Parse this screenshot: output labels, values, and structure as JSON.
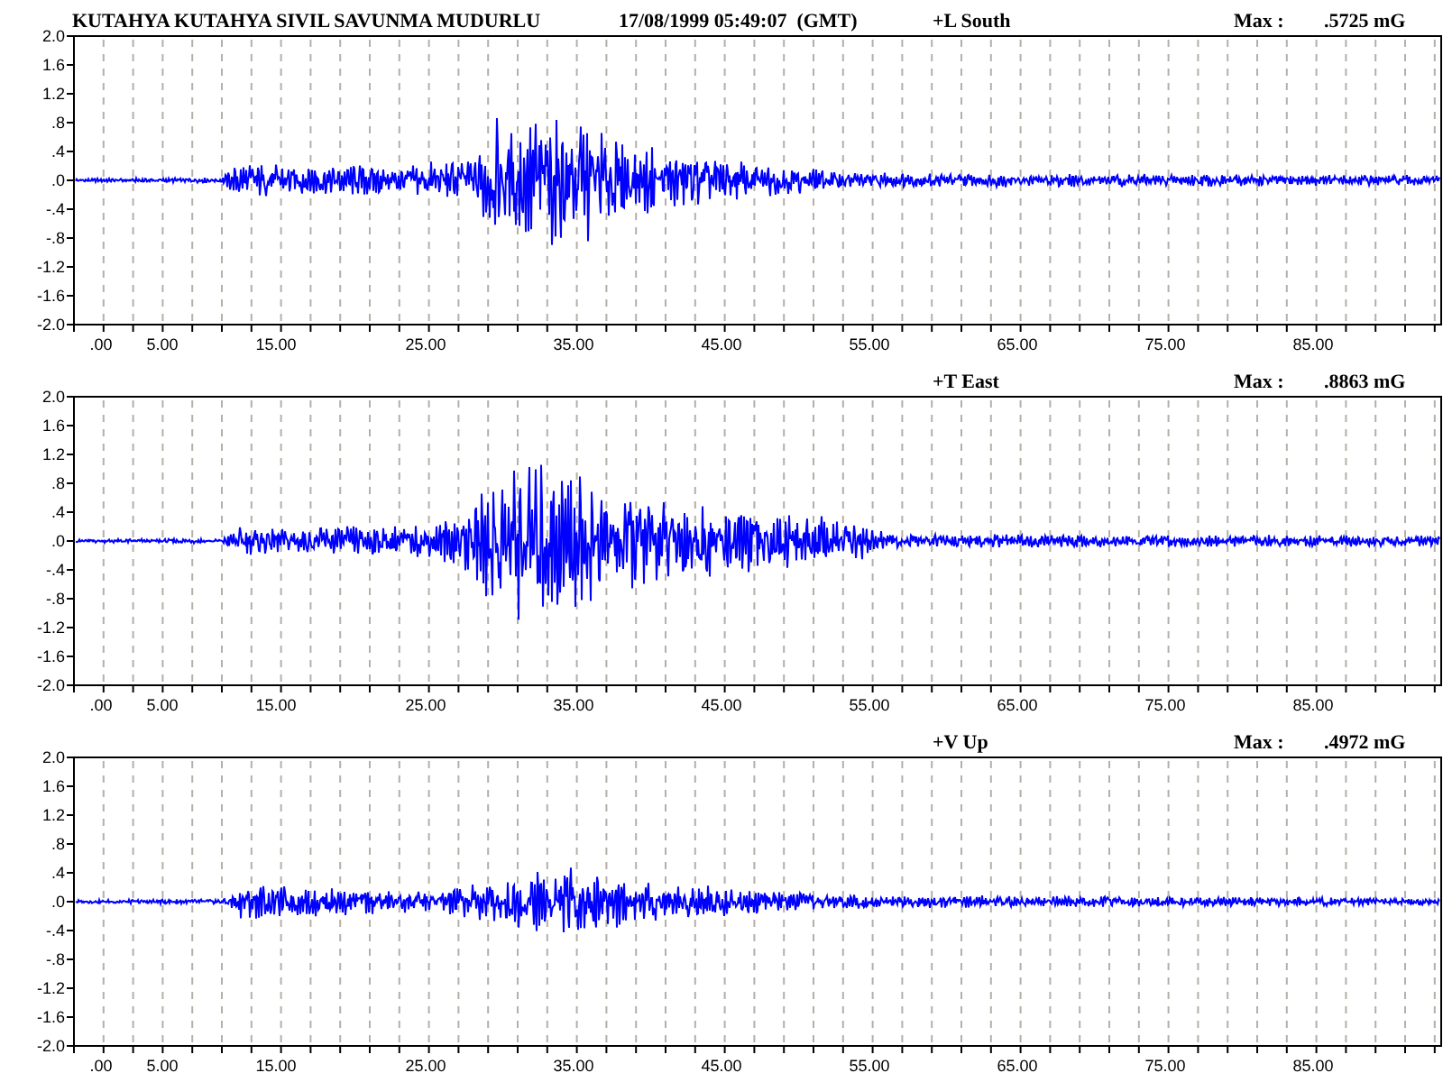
{
  "header": {
    "station": "KUTAHYA KUTAHYA SIVIL SAVUNMA MUDURLU",
    "datetime": "17/08/1999 05:49:07  (GMT)"
  },
  "channels": [
    {
      "component": "+L South",
      "max_label": "Max :",
      "max_value": ".5725 mG",
      "y_labels": [
        "2.0",
        "1.6",
        "1.2",
        ".8",
        ".4",
        ".0",
        "-.4",
        "-.8",
        "-1.2",
        "-1.6",
        "-2.0"
      ],
      "x_labels": [
        ".00",
        "5.00",
        "15.00",
        "25.00",
        "35.00",
        "45.00",
        "55.00",
        "65.00",
        "75.00",
        "85.00"
      ]
    },
    {
      "component": "+T East",
      "max_label": "Max :",
      "max_value": ".8863 mG",
      "y_labels": [
        "2.0",
        "1.6",
        "1.2",
        ".8",
        ".4",
        ".0",
        "-.4",
        "-.8",
        "-1.2",
        "-1.6",
        "-2.0"
      ],
      "x_labels": [
        ".00",
        "5.00",
        "15.00",
        "25.00",
        "35.00",
        "45.00",
        "55.00",
        "65.00",
        "75.00",
        "85.00"
      ]
    },
    {
      "component": "+V Up",
      "max_label": "Max :",
      "max_value": ".4972 mG",
      "y_labels": [
        "2.0",
        "1.6",
        "1.2",
        ".8",
        ".4",
        ".0",
        "-.4",
        "-.8",
        "-1.2",
        "-1.6",
        "-2.0"
      ],
      "x_labels": [
        ".00",
        "5.00",
        "15.00",
        "25.00",
        "35.00",
        "45.00",
        "55.00",
        "65.00",
        "75.00",
        "85.00"
      ]
    }
  ]
}
